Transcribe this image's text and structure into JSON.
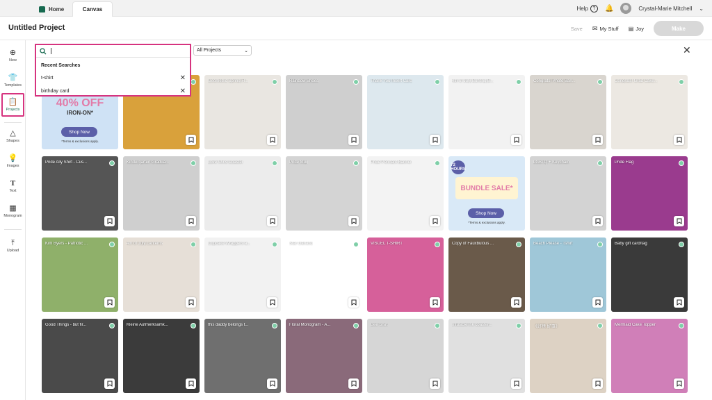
{
  "topbar": {
    "tabs": [
      {
        "label": "Home"
      },
      {
        "label": "Canvas"
      }
    ],
    "help_label": "Help",
    "help_glyph": "?",
    "user_name": "Crystal-Marie Mitchell"
  },
  "header": {
    "project_title": "Untitled Project",
    "save_label": "Save",
    "my_stuff_label": "My Stuff",
    "joy_label": "Joy",
    "make_label": "Make"
  },
  "sidebar": {
    "items": [
      {
        "label": "New",
        "icon": "plus-circle-icon"
      },
      {
        "label": "Templates",
        "icon": "shirt-icon"
      },
      {
        "label": "Projects",
        "icon": "projects-icon"
      },
      {
        "label": "Shapes",
        "icon": "shapes-icon"
      },
      {
        "label": "Images",
        "icon": "lightbulb-icon"
      },
      {
        "label": "Text",
        "icon": "text-icon"
      },
      {
        "label": "Monogram",
        "icon": "monogram-icon"
      },
      {
        "label": "Upload",
        "icon": "upload-icon"
      }
    ]
  },
  "search": {
    "value": "",
    "recent_heading": "Recent Searches",
    "recent": [
      "t-shirt",
      "birthday card"
    ]
  },
  "filter": {
    "selected": "All Projects"
  },
  "promo1": {
    "big": "40% OFF",
    "small": "IRON-ON*",
    "cta": "Shop Now",
    "terms": "*Terms & exclusions apply."
  },
  "promo2": {
    "badge": "72 HOURS",
    "big": "BUNDLE SALE*",
    "cta": "Shop Now",
    "terms": "*Terms & exclusions apply."
  },
  "projects": [
    {
      "title": "",
      "color": "#cfe2f5"
    },
    {
      "title": "",
      "color": "#d9a13b"
    },
    {
      "title": "Geometric Spring Fl...",
      "color": "#e9e6e1"
    },
    {
      "title": "Rainbow Shoes",
      "color": "#cfcfcf"
    },
    {
      "title": "Thank You Insert Card",
      "color": "#dde8ee"
    },
    {
      "title": "4th of July Bunting B...",
      "color": "#f2f2f2"
    },
    {
      "title": "Congrats! Photo Ban...",
      "color": "#d9d5cf"
    },
    {
      "title": "Congrats! Grad Cake...",
      "color": "#ece8e2"
    },
    {
      "title": "Pride Ally Shirt - Cus...",
      "color": "#555555"
    },
    {
      "title": "Kindergarten Gradua...",
      "color": "#cfcfcf"
    },
    {
      "title": "Love Wins Coaster",
      "color": "#ececec"
    },
    {
      "title": "Pride Mug",
      "color": "#d4d4d4"
    },
    {
      "title": "Pride Pennant Banner",
      "color": "#f3f3f3"
    },
    {
      "title": "",
      "color": "#d9e9f7"
    },
    {
      "title": "LGBTQ + Keychain",
      "color": "#d3d3d3"
    },
    {
      "title": "Pride Flag",
      "color": "#9a3b8e"
    },
    {
      "title": "Kim Byers - Patriotic ...",
      "color": "#8fb06a"
    },
    {
      "title": "4th of July Lanterns",
      "color": "#e6dfd7"
    },
    {
      "title": "Cupcake Wrappers a...",
      "color": "#f2f2f2"
    },
    {
      "title": "Star Garland",
      "color": "#ffffff"
    },
    {
      "title": "VISUEL T-SHIRT",
      "color": "#d6609a"
    },
    {
      "title": "Copy of Fauxbulous ...",
      "color": "#6a5a4a"
    },
    {
      "title": "Beach Please - Tshirt",
      "color": "#9fc7d8"
    },
    {
      "title": "Baby gift card/tag",
      "color": "#3a3a3a"
    },
    {
      "title": "Good Things - but fir...",
      "color": "#4a4a4a"
    },
    {
      "title": "Kleine Aufmerksamk...",
      "color": "#3b3b3b"
    },
    {
      "title": "this daddy belongs t...",
      "color": "#6f6f6f"
    },
    {
      "title": "Floral Monogram - A...",
      "color": "#8a6a7a"
    },
    {
      "title": "Bee Shirt",
      "color": "#d6d6d6"
    },
    {
      "title": "Infusible ink coaster...",
      "color": "#e0e0e0"
    },
    {
      "title": "《好榜 好事》",
      "color": "#ddd2c4"
    },
    {
      "title": "Mermaid Cake Topper",
      "color": "#d07fb8"
    }
  ]
}
